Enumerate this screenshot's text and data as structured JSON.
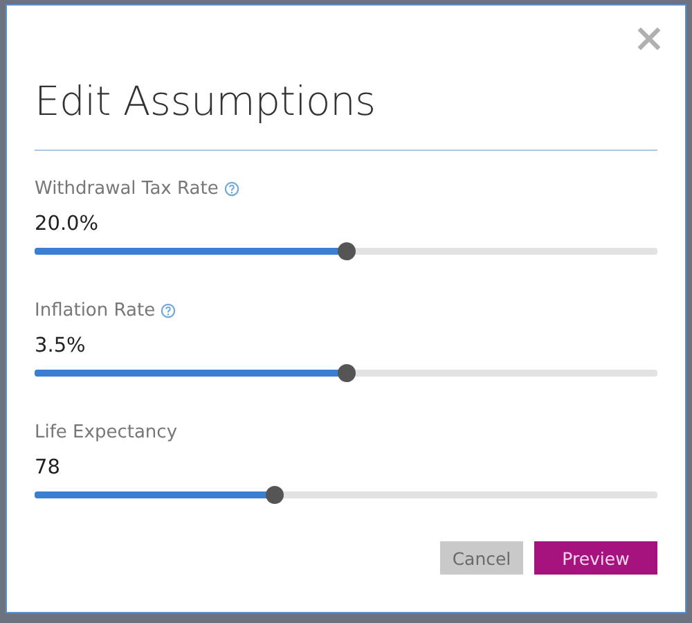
{
  "dialog": {
    "title": "Edit Assumptions"
  },
  "settings": [
    {
      "label": "Withdrawal Tax Rate",
      "help": true,
      "value": "20.0%",
      "level": 0.5
    },
    {
      "label": "Inflation Rate",
      "help": true,
      "value": "3.5%",
      "level": 0.5
    },
    {
      "label": "Life Expectancy",
      "help": false,
      "value": "78",
      "level": 0.385
    }
  ],
  "buttons": [
    {
      "label": "Cancel",
      "kind": "secondary"
    },
    {
      "label": "Preview",
      "kind": "primary"
    }
  ]
}
